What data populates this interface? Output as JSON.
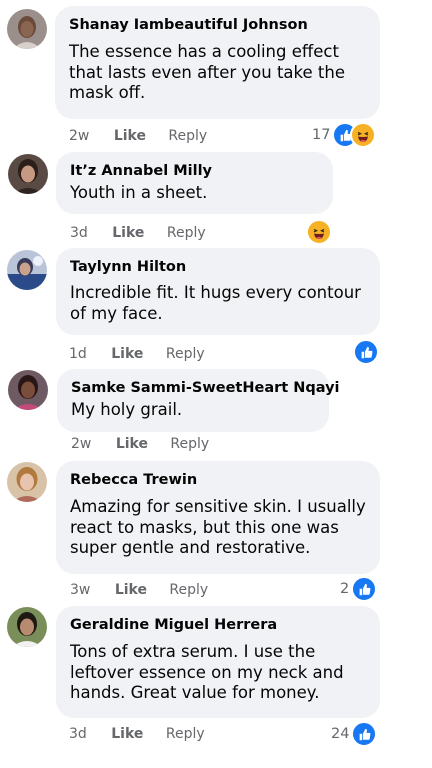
{
  "colors": {
    "bubble": "#f0f2f5",
    "like_blue": "#1877f2",
    "haha_yellow": "#f7b125",
    "meta_gray": "#65676b"
  },
  "comments": [
    {
      "author": "Shanay Iambeautiful Johnson",
      "text": "The essence has a cooling effect that lasts even after you take the mask off.",
      "time": "2w",
      "like_label": "Like",
      "reply_label": "Reply",
      "reaction_count": "17",
      "reactions": [
        "like-icon",
        "haha-icon"
      ]
    },
    {
      "author": "It’z Annabel Milly",
      "text": "Youth in a sheet.",
      "time": "3d",
      "like_label": "Like",
      "reply_label": "Reply",
      "reaction_count": "",
      "reactions": [
        "haha-icon"
      ]
    },
    {
      "author": "Taylynn Hilton",
      "text": "Incredible fit. It hugs every contour of my face.",
      "time": "1d",
      "like_label": "Like",
      "reply_label": "Reply",
      "reaction_count": "",
      "reactions": [
        "like-icon"
      ]
    },
    {
      "author": "Samke Sammi-SweetHeart Nqayi",
      "text": "My holy grail.",
      "time": "2w",
      "like_label": "Like",
      "reply_label": "Reply",
      "reaction_count": "",
      "reactions": []
    },
    {
      "author": "Rebecca Trewin",
      "text": "Amazing for sensitive skin. I usually react to masks, but this one was super gentle and restorative.",
      "time": "3w",
      "like_label": "Like",
      "reply_label": "Reply",
      "reaction_count": "2",
      "reactions": [
        "like-icon"
      ]
    },
    {
      "author": "Geraldine Miguel Herrera",
      "text": "Tons of extra serum. I use the leftover essence on my neck and hands. Great value for money.",
      "time": "3d",
      "like_label": "Like",
      "reply_label": "Reply",
      "reaction_count": "24",
      "reactions": [
        "like-icon"
      ]
    }
  ]
}
